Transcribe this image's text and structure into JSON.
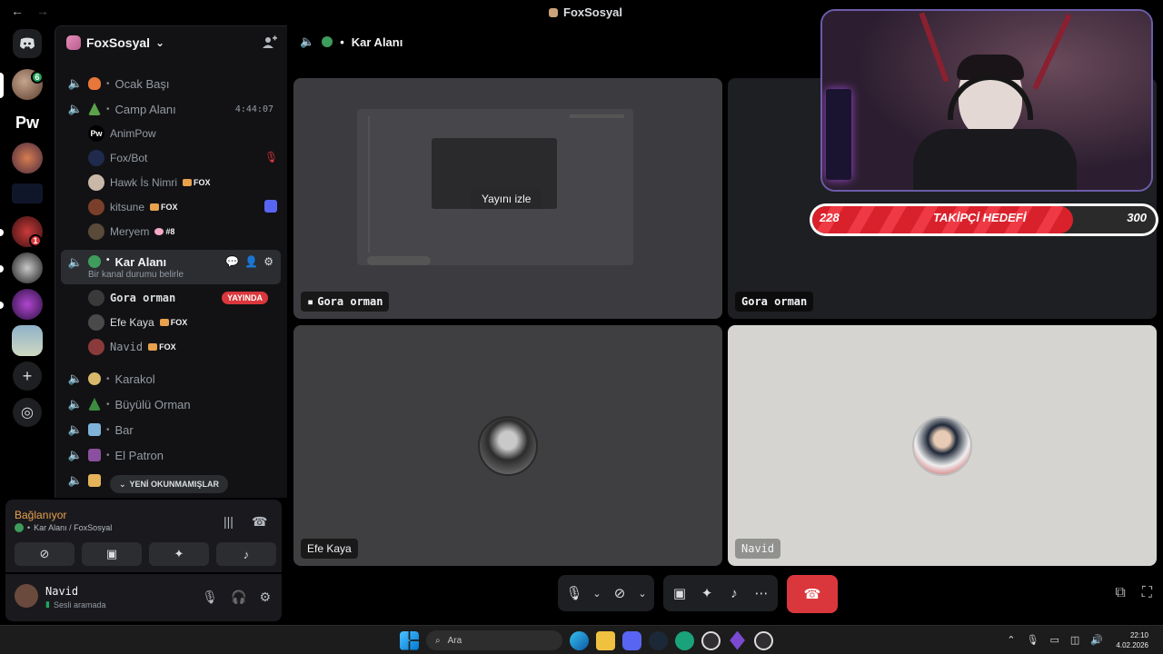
{
  "window": {
    "title": "FoxSosyal",
    "back_glyph": "←",
    "fwd_glyph": "→"
  },
  "rail": {
    "discord_home_icon": "discord-logo-icon",
    "badge_first": "6",
    "badge_fourth": "1",
    "add_icon": "+",
    "explore_icon": "◎"
  },
  "guild": {
    "name": "FoxSosyal",
    "chevron": "⌄"
  },
  "channels": [
    {
      "name": "Ocak Başı",
      "emoji_color": "#e8773a"
    },
    {
      "name": "Camp Alanı",
      "emoji_color": "#5aa34b",
      "timer": "4:44:07"
    },
    {
      "name": "Kar Alanı",
      "emoji_color": "#3e9c5c",
      "status": "Bir kanal durumu belirle"
    },
    {
      "name": "Karakol",
      "emoji_color": "#d8b86a"
    },
    {
      "name": "Büyülü Orman",
      "emoji_color": "#3b8c3f"
    },
    {
      "name": "Bar",
      "emoji_color": "#7fb3d9"
    },
    {
      "name": "El Patron",
      "emoji_color": "#8a4f9e"
    }
  ],
  "camp_users": [
    {
      "name": "AnimPow"
    },
    {
      "name": "Fox/Bot"
    },
    {
      "name": "Hawk İs Nimri",
      "tag": "FOX"
    },
    {
      "name": "kitsune",
      "tag": "FOX"
    },
    {
      "name": "Meryem",
      "tag": "#8"
    }
  ],
  "kar_users": [
    {
      "name": "Gora orman",
      "live": "YAYINDA"
    },
    {
      "name": "Efe Kaya",
      "tag": "FOX"
    },
    {
      "name": "Navid",
      "tag": "FOX"
    }
  ],
  "unread_pill": "YENİ OKUNMAMIŞLAR",
  "voice": {
    "status": "Bağlanıyor",
    "location": "Kar Alanı / FoxSosyal"
  },
  "me": {
    "name": "Navid",
    "status": "Sesli aramada"
  },
  "stage": {
    "channel": "Kar Alanı",
    "watch_label": "Yayını izle",
    "tiles": [
      {
        "label": "Gora orman"
      },
      {
        "label": "Gora orman"
      },
      {
        "label": "Efe Kaya"
      },
      {
        "label": "Navid"
      }
    ]
  },
  "goal": {
    "current": "228",
    "label": "TAKİPÇİ HEDEFİ",
    "target": "300",
    "progress": 0.76
  },
  "taskbar": {
    "search_placeholder": "Ara",
    "time": "22:10",
    "date": "4.02.2026"
  },
  "colors": {
    "accent": "#5865f2",
    "danger": "#da373c",
    "online": "#23a55a",
    "connecting": "#e8a14d"
  }
}
